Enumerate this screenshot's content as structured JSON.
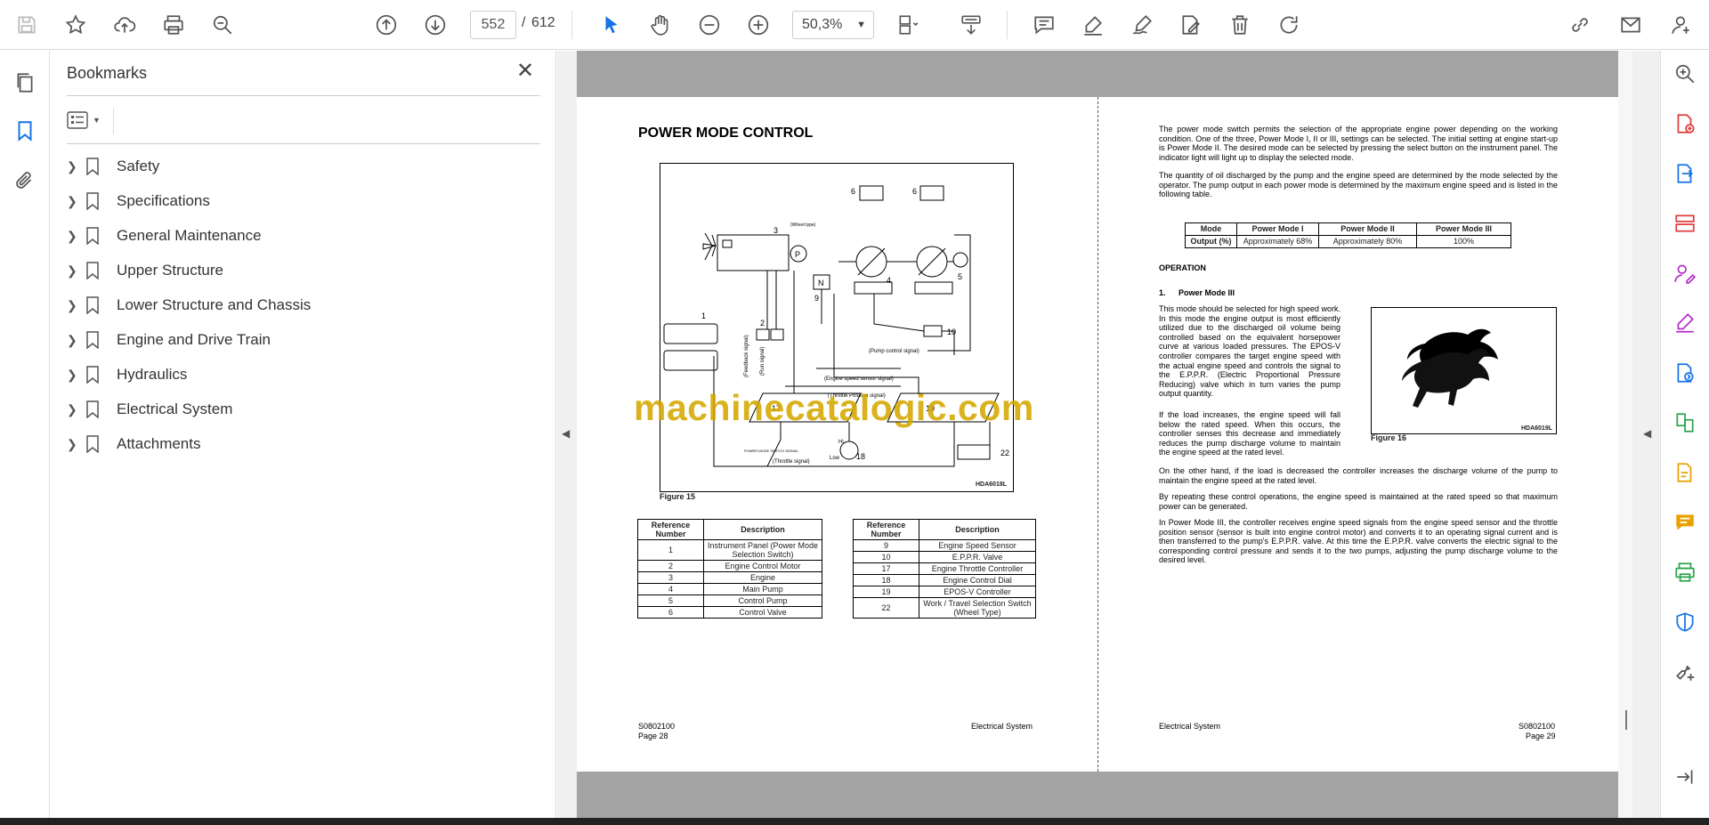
{
  "toolbar": {
    "icons": [
      "save-icon",
      "bookmark-star-icon",
      "upload-cloud-icon",
      "print-icon",
      "search-zoom-icon",
      "page-up-icon",
      "page-down-icon",
      "select-cursor-icon",
      "hand-pan-icon",
      "zoom-out-icon",
      "zoom-in-icon",
      "fit-page-icon",
      "scroll-mode-icon",
      "comment-icon",
      "highlight-pen-icon",
      "sign-icon",
      "fill-sign-icon",
      "delete-icon",
      "rotate-icon",
      "share-link-icon",
      "email-icon",
      "user-account-icon"
    ],
    "page_current": "552",
    "page_separator": "/",
    "page_total": "612",
    "zoom": "50,3%"
  },
  "bookmarks": {
    "title": "Bookmarks",
    "items": [
      {
        "label": "Safety"
      },
      {
        "label": "Specifications"
      },
      {
        "label": "General Maintenance"
      },
      {
        "label": "Upper Structure"
      },
      {
        "label": "Lower Structure and Chassis"
      },
      {
        "label": "Engine and Drive Train"
      },
      {
        "label": "Hydraulics"
      },
      {
        "label": "Electrical System"
      },
      {
        "label": "Attachments"
      }
    ]
  },
  "left_page": {
    "title": "POWER MODE CONTROL",
    "figure_caption": "Figure 15",
    "figure_code": "HDA6018L",
    "diagram_labels": {
      "n1": "1",
      "n2": "2",
      "n3": "3",
      "n4": "4",
      "n5": "5",
      "n6a": "6",
      "n6b": "6",
      "n9": "9",
      "n10": "10",
      "n17": "17",
      "n18": "18",
      "n19": "19",
      "n22": "22",
      "P": "P",
      "N": "N",
      "hi": "Hi",
      "low": "Low",
      "pump_signal": "(Pump control signal)",
      "engine_speed_signal": "(Engine speed sensor signal)",
      "throttle_pos_signal": "(Throttle Position signal)",
      "throttle_signal": "(Throttle signal)",
      "mode_switch_signal": "POWER MODE SWITCH SIGNAL",
      "feedback": "(Feedback signal)",
      "run_signal": "(Run signal)",
      "wheel_type": "(Wheel type)"
    },
    "table_left": {
      "headers": [
        "Reference Number",
        "Description"
      ],
      "rows": [
        [
          "1",
          "Instrument Panel (Power Mode Selection Switch)"
        ],
        [
          "2",
          "Engine Control Motor"
        ],
        [
          "3",
          "Engine"
        ],
        [
          "4",
          "Main Pump"
        ],
        [
          "5",
          "Control Pump"
        ],
        [
          "6",
          "Control Valve"
        ]
      ]
    },
    "table_right": {
      "headers": [
        "Reference Number",
        "Description"
      ],
      "rows": [
        [
          "9",
          "Engine Speed Sensor"
        ],
        [
          "10",
          "E.P.P.R. Valve"
        ],
        [
          "17",
          "Engine Throttle Controller"
        ],
        [
          "18",
          "Engine Control Dial"
        ],
        [
          "19",
          "EPOS-V Controller"
        ],
        [
          "22",
          "Work / Travel Selection Switch (Wheel Type)"
        ]
      ]
    },
    "footer_code": "S0802100",
    "footer_page": "Page 28",
    "footer_section": "Electrical System"
  },
  "right_page": {
    "para1": "The power mode switch permits the selection of the appropriate engine power depending on the working condition. One of the three, Power Mode I, II or III, settings can be selected. The initial setting at engine start-up is Power Mode II. The desired mode can be selected by pressing the select button on the instrument panel. The indicator light will light up to display the selected mode.",
    "para2": "The quantity of oil discharged by the pump and the engine speed are determined by the mode selected by the operator. The pump output in each power mode is determined by the maximum engine speed and is listed in the following table.",
    "mode_table": {
      "headers": [
        "Mode",
        "Power Mode I",
        "Power Mode II",
        "Power Mode III"
      ],
      "row": [
        "Output (%)",
        "Approximately 68%",
        "Approximately 80%",
        "100%"
      ]
    },
    "operation_heading": "OPERATION",
    "sub_number": "1.",
    "sub_heading": "Power Mode III",
    "para3": "This mode should be selected for high speed work. In this mode the engine output is most efficiently utilized due to the discharged oil volume being controlled based on the equivalent horsepower curve at various loaded pressures. The EPOS-V controller compares the target engine speed with the actual engine speed and controls the signal to the E.P.P.R. (Electric Proportional Pressure Reducing) valve which in turn varies the pump output quantity.",
    "para4": "If the load increases, the engine speed will fall below the rated speed. When this occurs, the controller senses this decrease and immediately reduces the pump discharge volume to maintain the engine speed at the rated level.",
    "para5": "On the other hand, if the load is decreased the controller increases the discharge volume of the pump to maintain the engine speed at the rated level.",
    "para6": "By repeating these control operations, the engine speed is maintained at the rated speed so that maximum power can be generated.",
    "para7": "In Power Mode III, the controller receives engine speed signals from the engine speed sensor and the throttle position sensor (sensor is built into engine control motor) and converts it to an operating signal current and is then transferred to the pump's E.P.P.R. valve. At this time the E.P.P.R. valve converts the electric signal to the corresponding control pressure and sends it to the two pumps, adjusting the pump discharge volume to the desired level.",
    "figure_caption": "Figure 16",
    "figure_code": "HDA6019L",
    "footer_section": "Electrical System",
    "footer_code": "S0802100",
    "footer_page": "Page 29"
  },
  "watermark": "machinecatalogic.com",
  "colors": {
    "accent_blue": "#1473e6",
    "tool_purple": "#b62fc9",
    "tool_red": "#e03b3b",
    "tool_green": "#2da44e",
    "tool_yellow": "#e8a200",
    "watermark_gold": "#d4a800"
  }
}
